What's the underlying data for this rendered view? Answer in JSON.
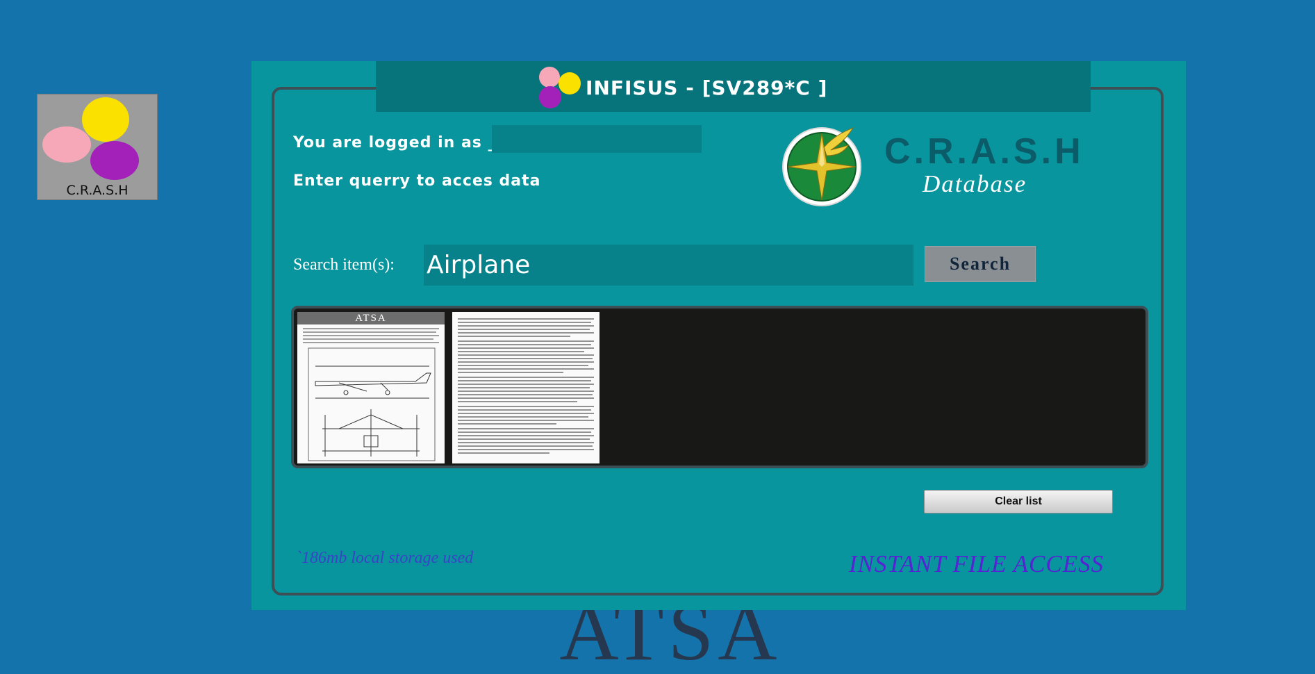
{
  "background_watermark": "ATSA",
  "desktop_icon": {
    "label": "C.R.A.S.H"
  },
  "window": {
    "title": "INFISUS - [SV289*C ]",
    "logged_in_label": "You are logged in as _",
    "username": "",
    "instruction": "Enter querry to acces data",
    "brand": {
      "name": "C.R.A.S.H",
      "subtitle": "Database"
    },
    "search": {
      "label": "Search item(s):",
      "value": "Airplane",
      "button_label": "Search"
    },
    "results": [
      {
        "name": "document-page-1",
        "header": "ATSA"
      },
      {
        "name": "document-page-2"
      }
    ],
    "clear_label": "Clear list",
    "storage_text": "`186mb local storage used",
    "tagline": "INSTANT FILE ACCESS"
  },
  "colors": {
    "desktop": "#1573ab",
    "window": "#08959d",
    "titlebar": "#07747c",
    "accent_text": "#5522d4"
  },
  "icons": [
    "crash-logo-icon",
    "winged-compass-icon"
  ]
}
